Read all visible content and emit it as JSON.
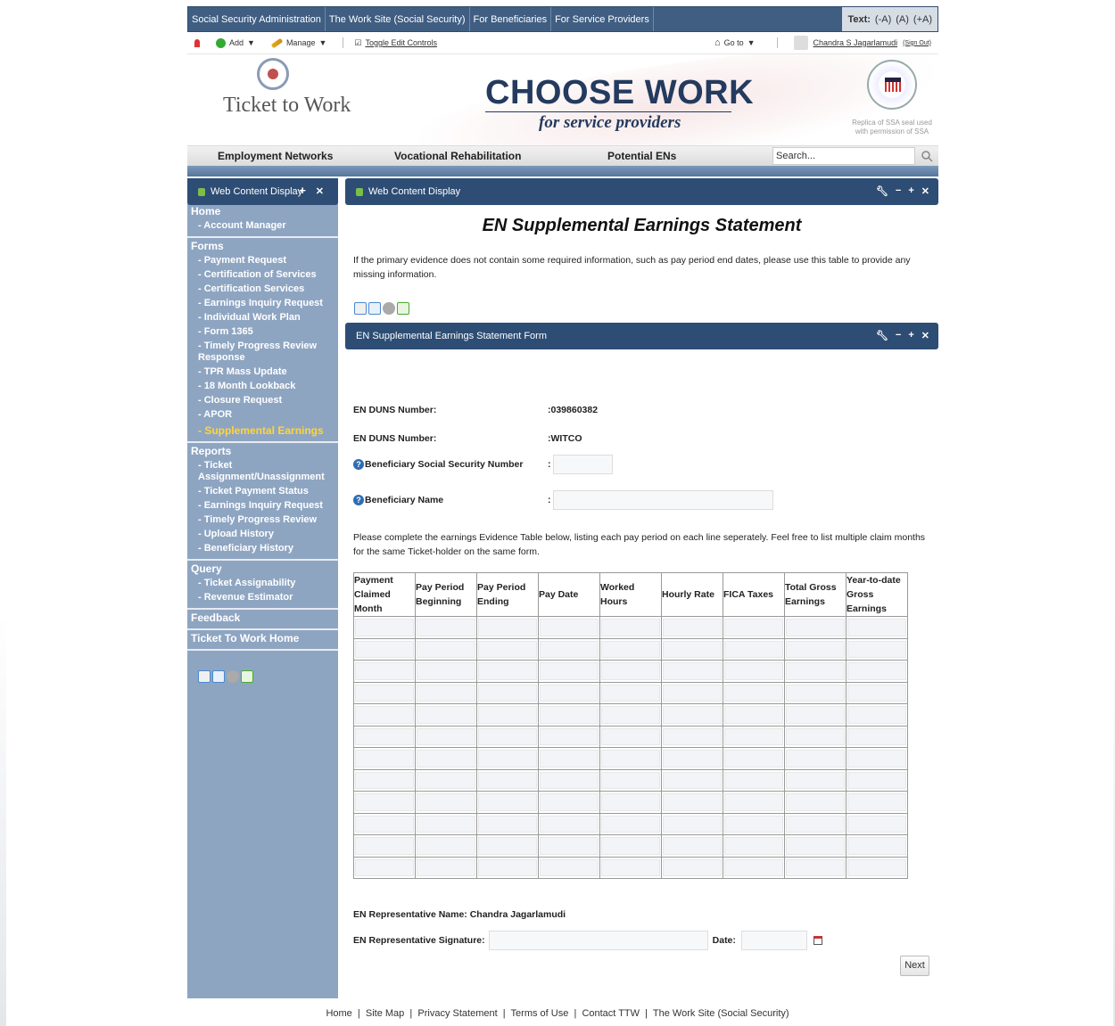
{
  "topbar": {
    "links": [
      "Social Security Administration",
      "The Work Site (Social Security)",
      "For Beneficiaries",
      "For Service Providers"
    ],
    "text_label": "Text:",
    "text_small": "(-A)",
    "text_normal": "(A)",
    "text_large": "(+A)"
  },
  "dockbar": {
    "add": "Add",
    "manage": "Manage",
    "toggle": "Toggle Edit Controls",
    "goto": "Go to",
    "user": "Chandra S Jagarlamudi",
    "signout": "(Sign Out)"
  },
  "banner": {
    "logo_text": "Ticket to Work",
    "headline": "CHOOSE WORK",
    "subheadline": "for service providers",
    "seal_note": "Replica of SSA seal used with permission of SSA"
  },
  "nav": {
    "items": [
      "Employment Networks",
      "Vocational Rehabilitation",
      "Potential ENs"
    ],
    "search_placeholder": "Search..."
  },
  "sidebar": {
    "portlet_title": "Web Content Display",
    "sections": [
      {
        "title": "Home",
        "items": [
          "- Account Manager"
        ]
      },
      {
        "title": "Forms",
        "items": [
          "- Payment Request",
          "- Certification of Services",
          "- Certification Services",
          "- Earnings Inquiry Request",
          "- Individual Work Plan",
          "- Form 1365",
          "- Timely Progress Review Response",
          "- TPR Mass Update",
          "- 18 Month Lookback",
          "- Closure Request",
          "- APOR"
        ],
        "active": "- Supplemental Earnings"
      },
      {
        "title": "Reports",
        "items": [
          "- Ticket Assignment/Unassignment",
          "- Ticket Payment Status",
          "- Earnings Inquiry Request",
          "- Timely Progress Review",
          "- Upload History",
          "- Beneficiary History"
        ]
      },
      {
        "title": "Query",
        "items": [
          "- Ticket Assignability",
          "- Revenue Estimator"
        ]
      },
      {
        "title": "Feedback",
        "items": []
      },
      {
        "title": "Ticket To Work Home",
        "items": []
      }
    ]
  },
  "main": {
    "portlet_title": "Web Content Display",
    "page_title": "EN Supplemental Earnings Statement",
    "intro": "If the primary evidence does not contain some required information, such as pay period end dates, please use this table to provide any missing information.",
    "form_title": "EN Supplemental Earnings Statement Form",
    "duns_label": "EN DUNS Number:",
    "duns_value": ":039860382",
    "duns2_label": "EN DUNS Number:",
    "duns2_value": ":WITCO",
    "ssn_label": "Beneficiary Social Security Number",
    "name_label": "Beneficiary Name",
    "colon": ":",
    "instructions": "Please complete the earnings Evidence Table below, listing each pay period on each line seperately. Feel free to list multiple claim months for the same Ticket-holder on the same form.",
    "table_headers": [
      "Payment Claimed Month",
      "Pay Period Beginning",
      "Pay Period Ending",
      "Pay Date",
      "Worked Hours",
      "Hourly Rate",
      "FICA Taxes",
      "Total Gross Earnings",
      "Year-to-date Gross Earnings"
    ],
    "table_rows": 12,
    "rep_name": "EN Representative Name: Chandra Jagarlamudi",
    "signature_label": "EN Representative Signature:",
    "date_label": "Date:",
    "next": "Next"
  },
  "footer": {
    "links": [
      "Home",
      "Site Map",
      "Privacy Statement",
      "Terms of Use",
      "Contact TTW",
      "The Work Site (Social Security)"
    ]
  }
}
